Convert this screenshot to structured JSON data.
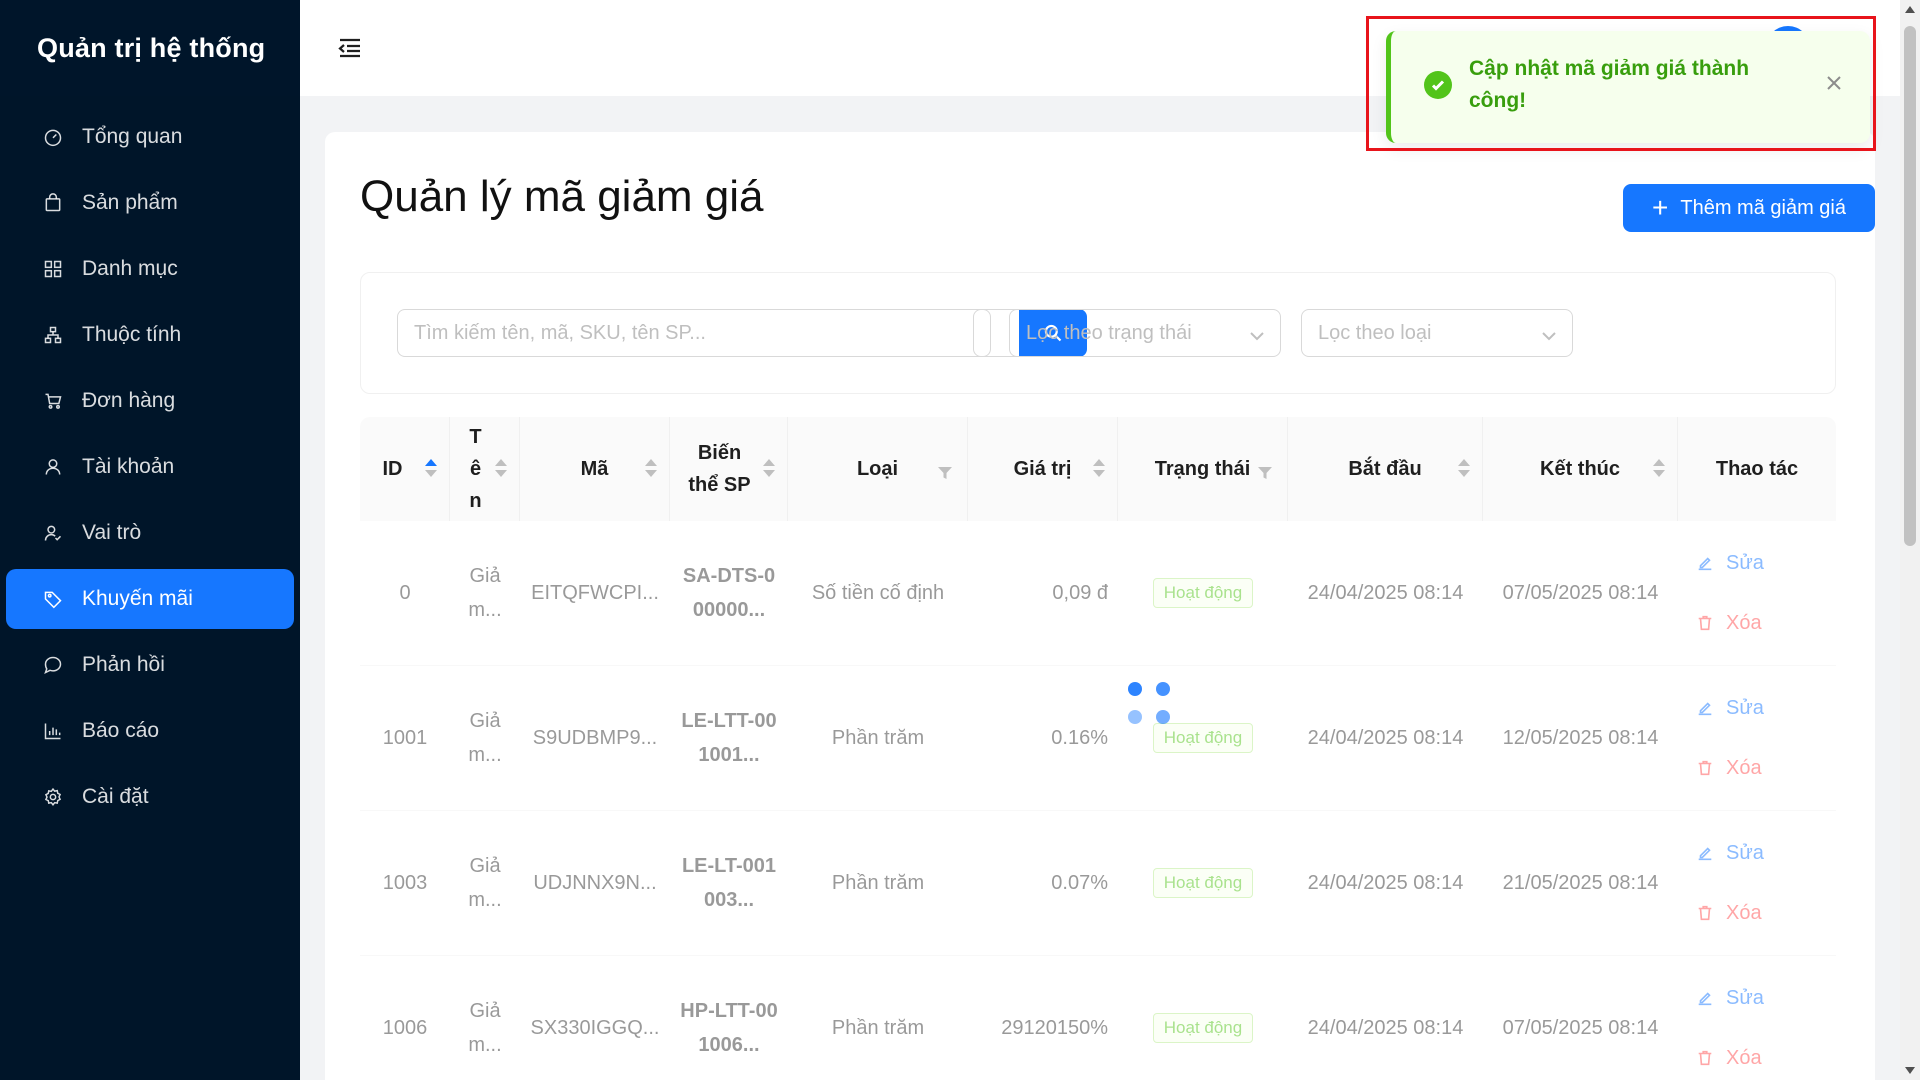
{
  "brand": {
    "title": "Quản trị hệ thống"
  },
  "sidebar": {
    "items": [
      {
        "label": "Tổng quan",
        "icon": "dashboard-icon"
      },
      {
        "label": "Sản phẩm",
        "icon": "shopping-bag-icon"
      },
      {
        "label": "Danh mục",
        "icon": "grid-icon"
      },
      {
        "label": "Thuộc tính",
        "icon": "cluster-icon"
      },
      {
        "label": "Đơn hàng",
        "icon": "cart-icon"
      },
      {
        "label": "Tài khoản",
        "icon": "user-icon"
      },
      {
        "label": "Vai trò",
        "icon": "team-icon"
      },
      {
        "label": "Khuyến mãi",
        "icon": "tag-icon",
        "active": true
      },
      {
        "label": "Phản hồi",
        "icon": "comment-icon"
      },
      {
        "label": "Báo cáo",
        "icon": "bar-chart-icon"
      },
      {
        "label": "Cài đặt",
        "icon": "gear-icon"
      }
    ]
  },
  "page": {
    "title": "Quản lý mã giảm giá",
    "add_button": "Thêm mã giảm giá"
  },
  "filters": {
    "search_placeholder": "Tìm kiếm tên, mã, SKU, tên SP...",
    "status_placeholder": "Lọc theo trạng thái",
    "type_placeholder": "Lọc theo loại"
  },
  "table": {
    "headers": {
      "id": "ID",
      "name": "Tên",
      "code": "Mã",
      "variant": "Biến thể SP",
      "type": "Loại",
      "value": "Giá trị",
      "status": "Trạng thái",
      "start": "Bắt đầu",
      "end": "Kết thúc",
      "actions": "Thao tác"
    },
    "rows": [
      {
        "id": "0",
        "name": "Giả m...",
        "code": "EITQFWCPI...",
        "variant": "SA-DTS-000000...",
        "type": "Số tiền cố định",
        "value": "0,09 đ",
        "status": "Hoạt động",
        "start": "24/04/2025 08:14",
        "end": "07/05/2025 08:14",
        "edit": "Sửa",
        "delete": "Xóa"
      },
      {
        "id": "1001",
        "name": "Giả m...",
        "code": "S9UDBMP9...",
        "variant": "LE-LTT-001001...",
        "type": "Phần trăm",
        "value": "0.16%",
        "status": "Hoạt động",
        "start": "24/04/2025 08:14",
        "end": "12/05/2025 08:14",
        "edit": "Sửa",
        "delete": "Xóa"
      },
      {
        "id": "1003",
        "name": "Giả m...",
        "code": "UDJNNX9N...",
        "variant": "LE-LT-001003...",
        "type": "Phần trăm",
        "value": "0.07%",
        "status": "Hoạt động",
        "start": "24/04/2025 08:14",
        "end": "21/05/2025 08:14",
        "edit": "Sửa",
        "delete": "Xóa"
      },
      {
        "id": "1006",
        "name": "Giả m...",
        "code": "SX330IGGQ...",
        "variant": "HP-LTT-001006...",
        "type": "Phần trăm",
        "value": "29120150%",
        "status": "Hoạt động",
        "start": "24/04/2025 08:14",
        "end": "07/05/2025 08:14",
        "edit": "Sửa",
        "delete": "Xóa"
      }
    ]
  },
  "toast": {
    "message": "Cập nhật mã giảm giá thành công!",
    "type": "success",
    "color": "#52c41a"
  },
  "colors": {
    "sidebar_bg": "#001529",
    "primary": "#1677ff",
    "success": "#52c41a",
    "danger": "#ff4d4f",
    "highlight": "#e8141b"
  }
}
